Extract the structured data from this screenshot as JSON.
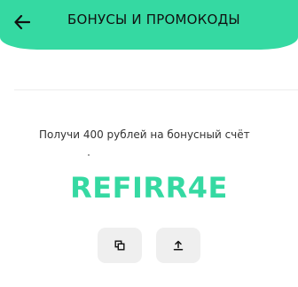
{
  "header": {
    "title": "БОНУСЫ И ПРОМОКОДЫ",
    "background_color": "#35d9a2",
    "back_icon": "arrow-left-icon"
  },
  "promo": {
    "subtitle": "Получи 400 рублей на бонусный счёт",
    "code": "REFIRR4E",
    "code_color": "#35d9a2"
  },
  "actions": {
    "copy_icon": "copy-icon",
    "share_icon": "share-upload-icon"
  }
}
